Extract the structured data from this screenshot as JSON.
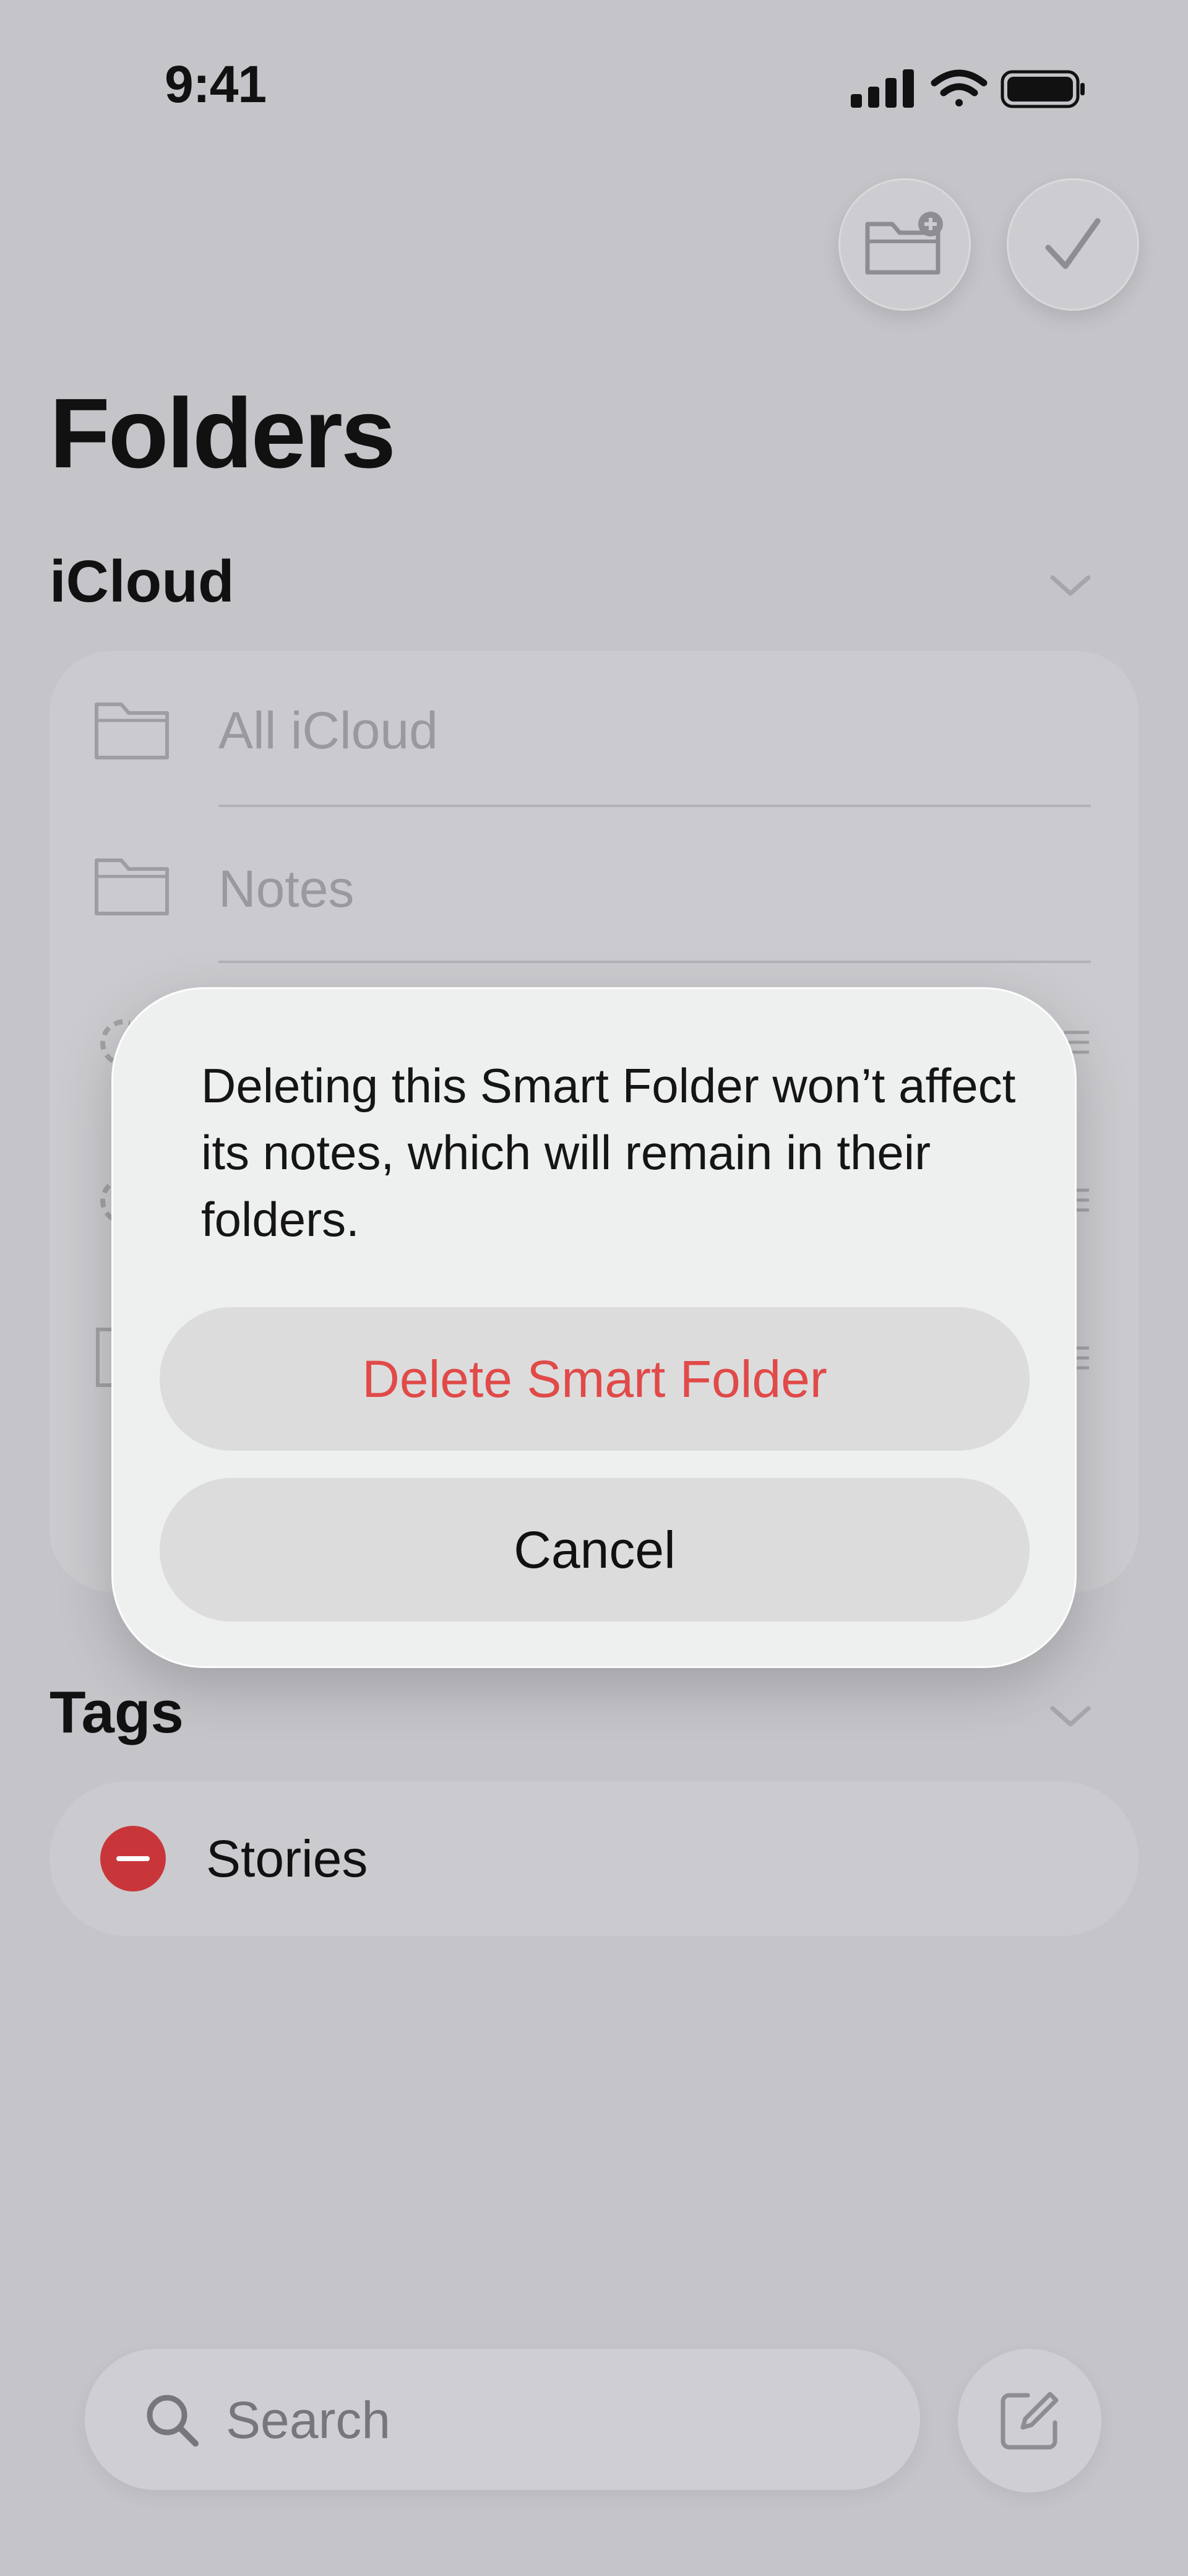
{
  "status_bar": {
    "time": "9:41"
  },
  "header": {
    "title": "Folders"
  },
  "icloud": {
    "title": "iCloud",
    "folders": [
      {
        "label": "All iCloud"
      },
      {
        "label": "Notes"
      }
    ]
  },
  "tags": {
    "title": "Tags",
    "items": [
      {
        "label": "Stories"
      }
    ]
  },
  "dialog": {
    "message": "Deleting this Smart Folder won’t affect its notes, which will remain in their folders.",
    "delete_label": "Delete Smart Folder",
    "cancel_label": "Cancel"
  },
  "search": {
    "placeholder": "Search"
  },
  "colors": {
    "destructive": "#e04a48",
    "tag_remove": "#c9363a",
    "background": "#c4c4c9",
    "dialog": "#eef0f0"
  },
  "icons": [
    "signal-icon",
    "wifi-icon",
    "battery-icon",
    "new-folder-icon",
    "checkmark-icon",
    "chevron-down-icon",
    "folder-icon",
    "gear-icon",
    "minus-icon",
    "search-icon",
    "compose-icon"
  ]
}
